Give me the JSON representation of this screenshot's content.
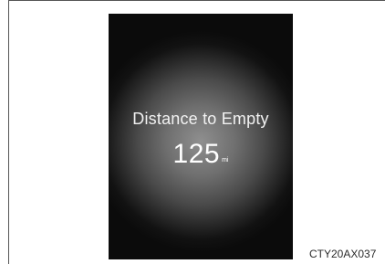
{
  "display": {
    "label": "Distance to Empty",
    "value": "125",
    "unit": "mi"
  },
  "figure": {
    "caption": "CTY20AX037"
  }
}
